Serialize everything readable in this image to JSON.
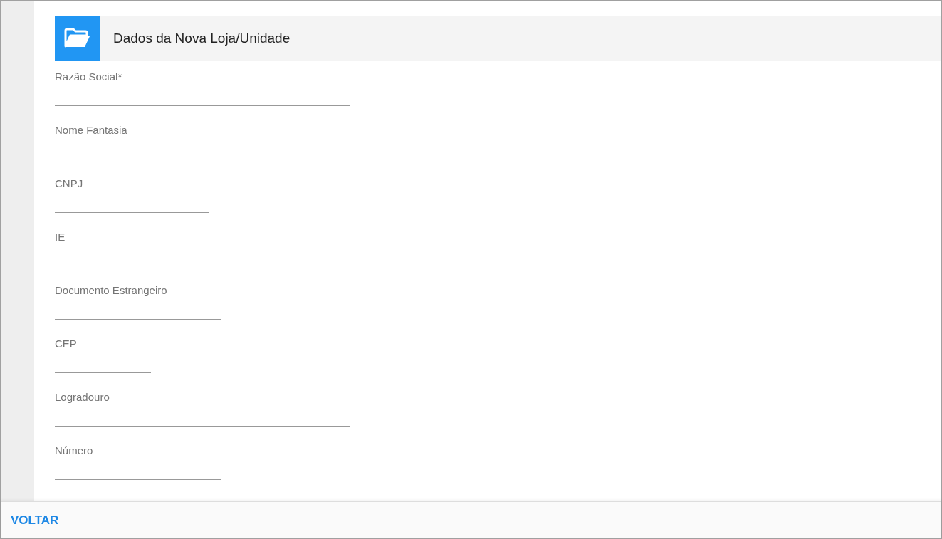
{
  "header": {
    "title": "Dados da Nova Loja/Unidade"
  },
  "fields": [
    {
      "label": "Razão Social*"
    },
    {
      "label": "Nome Fantasia"
    },
    {
      "label": "CNPJ"
    },
    {
      "label": "IE"
    },
    {
      "label": "Documento Estrangeiro"
    },
    {
      "label": "CEP"
    },
    {
      "label": "Logradouro"
    },
    {
      "label": "Número"
    }
  ],
  "footer": {
    "buttons": [
      "VOLTAR"
    ]
  }
}
